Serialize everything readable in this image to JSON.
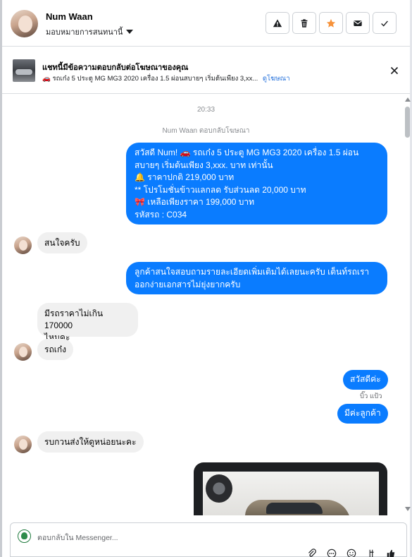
{
  "header": {
    "contact_name": "Num Waan",
    "assign_label": "มอบหมายการสนทนานี้",
    "buttons": [
      {
        "name": "spam-button",
        "icon": "warning-icon"
      },
      {
        "name": "delete-button",
        "icon": "trash-icon"
      },
      {
        "name": "star-button",
        "icon": "star-icon",
        "color": "#f7923a"
      },
      {
        "name": "mark-unread-button",
        "icon": "envelope-icon"
      },
      {
        "name": "mark-done-button",
        "icon": "check-icon"
      }
    ]
  },
  "ad_banner": {
    "title": "แชทนี้มีข้อความตอบกลับต่อโฆษณาของคุณ",
    "subtitle": "🚗 รถเก๋ง 5 ประตู MG MG3 2020 เครื่อง 1.5 ผ่อนสบายๆ เริ่มต้นเพียง 3,xx...",
    "link_label": "ดูโฆษณา"
  },
  "chat": {
    "timestamp": "20:33",
    "reply_note": "Num Waan ตอบกลับโฆษณา",
    "messages": [
      {
        "direction": "out",
        "lines": [
          "สวัสดี Num! 🚗 รถเก๋ง 5 ประตู MG MG3 2020 เครื่อง 1.5 ผ่อน",
          "สบายๆ เริ่มต้นเพียง 3,xxx. บาท เท่านั้น",
          "🔔 ราคาปกติ 219,000 บาท",
          "** โปรโมชั่นข้าวแลกลด รับส่วนลด 20,000 บาท",
          "🎀  เหลือเพียงราคา 199,000 บาท",
          " รหัสรถ : C034"
        ]
      },
      {
        "direction": "in",
        "text": "สนใจครับ"
      },
      {
        "direction": "out",
        "lines": [
          "ลูกค้าสนใจสอบถามรายละเอียดเพิ่มเติมได้เลยนะครับ เต็นท์รถเรา",
          "ออกง่ายเอกสารไม่ยุ่งยากครับ"
        ]
      },
      {
        "direction": "in",
        "lines": [
          "มีรถราคาไม่เกิน 170000",
          "ไหมคะ"
        ]
      },
      {
        "direction": "in",
        "text": "รถเก๋ง"
      },
      {
        "direction": "out",
        "text": "สวัสดีค่ะ"
      },
      {
        "direction": "out",
        "text": "มีค่ะลูกค้า",
        "sender": "บิ๊ว แป้ว"
      },
      {
        "direction": "in",
        "text": "รบกวนส่งให้ดูหน่อยนะคะ"
      },
      {
        "direction": "out",
        "type": "photo",
        "description": "car-photo"
      }
    ]
  },
  "composer": {
    "placeholder": "ตอบกลับใน Messenger...",
    "tools": [
      "attach-icon",
      "more-icon",
      "emoji-icon",
      "gif-icon",
      "like-icon"
    ]
  },
  "colors": {
    "outgoing_bubble": "#0a7cff",
    "incoming_bubble": "#f0f0f0",
    "link": "#216fdb",
    "star": "#f7923a"
  }
}
